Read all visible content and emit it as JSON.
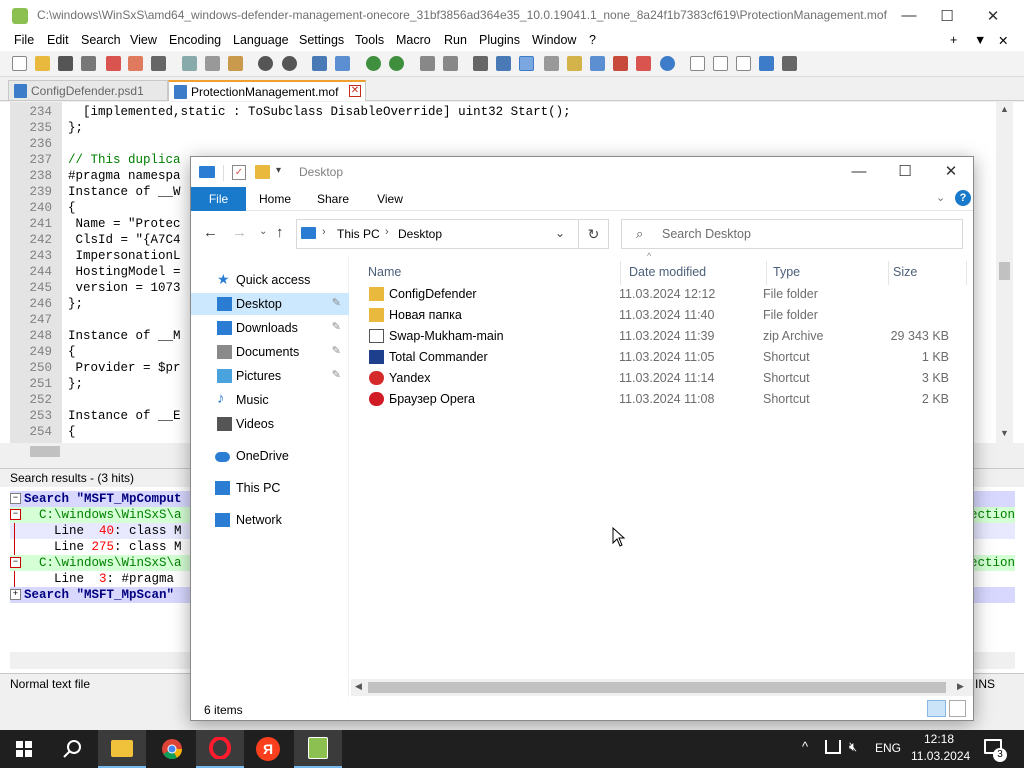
{
  "npp": {
    "title": "C:\\windows\\WinSxS\\amd64_windows-defender-management-onecore_31bf3856ad364e35_10.0.19041.1_none_8a24f1b7383cf619\\ProtectionManagement.mof...",
    "menus": [
      "File",
      "Edit",
      "Search",
      "View",
      "Encoding",
      "Language",
      "Settings",
      "Tools",
      "Macro",
      "Run",
      "Plugins",
      "Window",
      "?"
    ],
    "menu_right": [
      "+",
      "▼",
      "✕"
    ],
    "tabs": [
      "ConfigDefender.psd1",
      "ProtectionManagement.mof"
    ],
    "lines": [
      {
        "n": "234",
        "code": "  [implemented,static : ToSubclass DisableOverride] uint32 Start();"
      },
      {
        "n": "235",
        "code": "};"
      },
      {
        "n": "236",
        "code": ""
      },
      {
        "n": "237",
        "code": "// This duplica"
      },
      {
        "n": "238",
        "code": "#pragma namespa"
      },
      {
        "n": "239",
        "code": "Instance of __W"
      },
      {
        "n": "240",
        "code": "{"
      },
      {
        "n": "241",
        "code": " Name = \"Protec"
      },
      {
        "n": "242",
        "code": " ClsId = \"{A7C4"
      },
      {
        "n": "243",
        "code": " ImpersonationL"
      },
      {
        "n": "244",
        "code": " HostingModel ="
      },
      {
        "n": "245",
        "code": " version = 1073"
      },
      {
        "n": "246",
        "code": "};"
      },
      {
        "n": "247",
        "code": ""
      },
      {
        "n": "248",
        "code": "Instance of __M"
      },
      {
        "n": "249",
        "code": "{"
      },
      {
        "n": "250",
        "code": " Provider = $pr"
      },
      {
        "n": "251",
        "code": "};"
      },
      {
        "n": "252",
        "code": ""
      },
      {
        "n": "253",
        "code": "Instance of __E"
      },
      {
        "n": "254",
        "code": "{"
      }
    ],
    "search_header": "Search results - (3 hits)",
    "search_lines": [
      {
        "kind": "search",
        "text": "Search \"MSFT_MpComput"
      },
      {
        "kind": "file",
        "text": "  C:\\windows\\WinSxS\\a",
        "right": "ection"
      },
      {
        "kind": "hit",
        "prefix": "    Line  ",
        "num": "40",
        "text": ": class M"
      },
      {
        "kind": "hit",
        "prefix": "    Line ",
        "num": "275",
        "text": ": class M"
      },
      {
        "kind": "file",
        "text": "  C:\\windows\\WinSxS\\a",
        "right": "ection"
      },
      {
        "kind": "hit",
        "prefix": "    Line  ",
        "num": "3",
        "text": ": #pragma"
      },
      {
        "kind": "search",
        "text": "Search \"MSFT_MpScan\""
      }
    ],
    "status_left": "Normal text file",
    "status_right": "INS"
  },
  "explorer": {
    "title": "Desktop",
    "ribbon_tabs": [
      "File",
      "Home",
      "Share",
      "View"
    ],
    "breadcrumb": [
      "This PC",
      "Desktop"
    ],
    "search_placeholder": "Search Desktop",
    "nav": [
      {
        "label": "Quick access",
        "icon": "star-icon",
        "pinned": false
      },
      {
        "label": "Desktop",
        "icon": "desktop-folder-icon",
        "pinned": true,
        "selected": true
      },
      {
        "label": "Downloads",
        "icon": "downloads-icon",
        "pinned": true
      },
      {
        "label": "Documents",
        "icon": "documents-icon",
        "pinned": true
      },
      {
        "label": "Pictures",
        "icon": "pictures-icon",
        "pinned": true
      },
      {
        "label": "Music",
        "icon": "music-icon",
        "pinned": false
      },
      {
        "label": "Videos",
        "icon": "videos-icon",
        "pinned": false
      },
      {
        "label": "OneDrive",
        "icon": "onedrive-icon",
        "pinned": false
      },
      {
        "label": "This PC",
        "icon": "this-pc-icon",
        "pinned": false
      },
      {
        "label": "Network",
        "icon": "network-icon",
        "pinned": false
      }
    ],
    "columns": [
      "Name",
      "Date modified",
      "Type",
      "Size"
    ],
    "files": [
      {
        "name": "ConfigDefender",
        "date": "11.03.2024 12:12",
        "type": "File folder",
        "size": "",
        "icon": "folder-icon",
        "color": "#e8b93c"
      },
      {
        "name": "Новая папка",
        "date": "11.03.2024 11:40",
        "type": "File folder",
        "size": "",
        "icon": "folder-icon",
        "color": "#e8b93c"
      },
      {
        "name": "Swap-Mukham-main",
        "date": "11.03.2024 11:39",
        "type": "zip Archive",
        "size": "29 343 KB",
        "icon": "zip-icon",
        "color": "#6b6b6b"
      },
      {
        "name": "Total Commander",
        "date": "11.03.2024 11:05",
        "type": "Shortcut",
        "size": "1 KB",
        "icon": "total-commander-icon",
        "color": "#1d3f8c"
      },
      {
        "name": "Yandex",
        "date": "11.03.2024 11:14",
        "type": "Shortcut",
        "size": "3 KB",
        "icon": "yandex-icon",
        "color": "#d42a2a"
      },
      {
        "name": "Браузер Opera",
        "date": "11.03.2024 11:08",
        "type": "Shortcut",
        "size": "2 KB",
        "icon": "opera-icon",
        "color": "#d11c26"
      }
    ],
    "status": "6 items"
  },
  "taskbar": {
    "lang": "ENG",
    "time": "12:18",
    "date": "11.03.2024",
    "notifications": "3"
  }
}
